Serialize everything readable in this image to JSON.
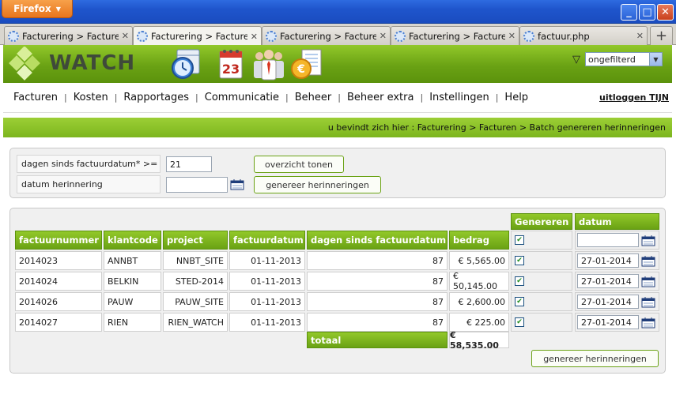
{
  "browser": {
    "app_button": "Firefox",
    "tabs": [
      {
        "title": "Facturering > Facture...",
        "active": false
      },
      {
        "title": "Facturering > Facture...",
        "active": true
      },
      {
        "title": "Facturering > Facture...",
        "active": false
      },
      {
        "title": "Facturering > Facture...",
        "active": false
      },
      {
        "title": "factuur.php",
        "active": false
      }
    ]
  },
  "header": {
    "logo_text": "WATCH",
    "calendar_day": "23",
    "filter_value": "ongefilterd"
  },
  "nav": {
    "items": [
      "Facturen",
      "Kosten",
      "Rapportages",
      "Communicatie",
      "Beheer",
      "Beheer extra",
      "Instellingen",
      "Help"
    ],
    "logout": "uitloggen TIJN"
  },
  "breadcrumb": "u bevindt zich hier : Facturering > Facturen > Batch genereren herinneringen",
  "filters": {
    "days_label": "dagen sinds factuurdatum* >=",
    "days_value": "21",
    "date_label": "datum herinnering",
    "date_value": "",
    "overview_button": "overzicht tonen",
    "generate_button": "genereer herinneringen"
  },
  "table": {
    "group_headers": {
      "generate": "Genereren",
      "date": "datum"
    },
    "columns": [
      "factuurnummer",
      "klantcode",
      "project",
      "factuurdatum",
      "dagen sinds factuurdatum",
      "bedrag"
    ],
    "header_date_value": "",
    "rows": [
      {
        "factuurnummer": "2014023",
        "klantcode": "ANNBT",
        "project": "NNBT_SITE",
        "factuurdatum": "01-11-2013",
        "dagen": "87",
        "bedrag": "€ 5,565.00",
        "checked": true,
        "datum": "27-01-2014"
      },
      {
        "factuurnummer": "2014024",
        "klantcode": "BELKIN",
        "project": "STED-2014",
        "factuurdatum": "01-11-2013",
        "dagen": "87",
        "bedrag": "€ 50,145.00",
        "checked": true,
        "datum": "27-01-2014"
      },
      {
        "factuurnummer": "2014026",
        "klantcode": "PAUW",
        "project": "PAUW_SITE",
        "factuurdatum": "01-11-2013",
        "dagen": "87",
        "bedrag": "€ 2,600.00",
        "checked": true,
        "datum": "27-01-2014"
      },
      {
        "factuurnummer": "2014027",
        "klantcode": "RIEN",
        "project": "RIEN_WATCH",
        "factuurdatum": "01-11-2013",
        "dagen": "87",
        "bedrag": "€ 225.00",
        "checked": true,
        "datum": "27-01-2014"
      }
    ],
    "total_label": "totaal",
    "total_value": "€ 58,535.00",
    "generate_button": "genereer herinneringen"
  }
}
